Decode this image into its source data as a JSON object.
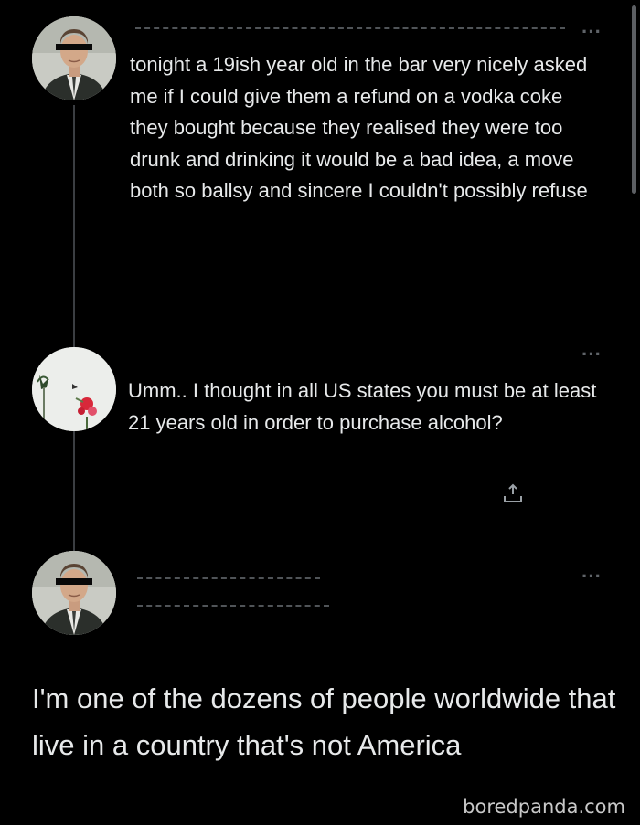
{
  "tweet1": {
    "avatar_icon": "masked-man-avatar-icon",
    "text": "tonight a 19ish year old in the bar very nicely asked me if I could give them a refund on a vodka coke they bought because they realised they were too drunk and drinking it would be a bad idea, a move both so ballsy and sincere I couldn't possibly refuse"
  },
  "reply": {
    "avatar_icon": "flower-avatar-icon",
    "text": "Umm.. I thought in all US states you must be at least 21 years old in order to purchase alcohol?"
  },
  "tweet2": {
    "avatar_icon": "masked-man-avatar-icon",
    "text": "I'm one of the dozens of people worldwide that live in a country that's not America"
  },
  "more_label": "···",
  "watermark": "boredpanda.com"
}
